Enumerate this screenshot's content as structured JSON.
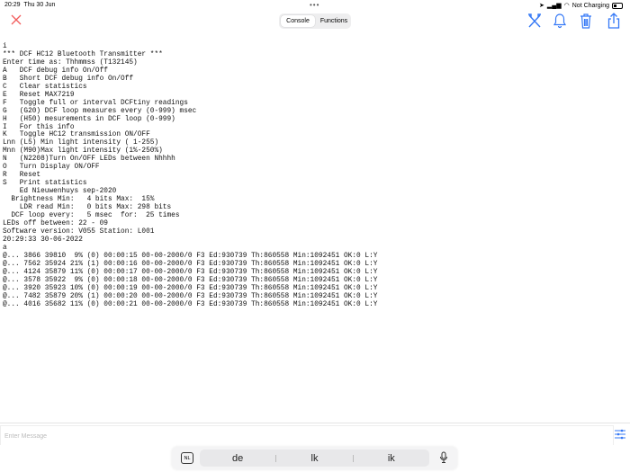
{
  "status_bar": {
    "time": "20:29",
    "date": "Thu 30 Jun",
    "dots": "•••",
    "battery_text": "Not Charging"
  },
  "toolbar": {
    "segments": [
      {
        "label": "Console",
        "active": true
      },
      {
        "label": "Functions",
        "active": false
      }
    ],
    "close_color": "#f25c5c",
    "accent": "#3478f6"
  },
  "console": {
    "lines": [
      "i",
      "*** DCF HC12 Bluetooth Transmitter ***",
      "Enter time as: Thhmmss (T132145)",
      "A   DCF debug info On/Off",
      "B   Short DCF debug info On/Off",
      "C   Clear statistics",
      "E   Reset MAX7219",
      "F   Toggle full or interval DCFtiny readings",
      "G   (G20) DCF loop measures every (0-999) msec",
      "H   (H50) mesurements in DCF loop (0-999)",
      "I   For this info",
      "K   Toggle HC12 transmission ON/OFF",
      "Lnn (L5) Min light intensity ( 1-255)",
      "Mnn (M90)Max light intensity (1%-250%)",
      "N   (N2208)Turn On/OFF LEDs between Nhhhh",
      "O   Turn Display ON/OFF",
      "R   Reset",
      "S   Print statistics",
      "    Ed Nieuwenhuys sep-2020",
      "  Brightness Min:   4 bits Max:  15%",
      "    LDR read Min:   0 bits Max: 298 bits",
      "  DCF loop every:   5 msec  for:  25 times",
      "LEDs off between: 22 - 09",
      "Software version: V055 Station: L001",
      "20:29:33 30-06-2022",
      "a",
      "@... 3866 39810  9% (0) 00:00:15 00-00-2000/0 F3 Ed:930739 Th:860558 Min:1092451 OK:0 L:Y",
      "@... 7562 35924 21% (1) 00:00:16 00-00-2000/0 F3 Ed:930739 Th:860558 Min:1092451 OK:0 L:Y",
      "@... 4124 35879 11% (0) 00:00:17 00-00-2000/0 F3 Ed:930739 Th:860558 Min:1092451 OK:0 L:Y",
      "@... 3578 35922  9% (0) 00:00:18 00-00-2000/0 F3 Ed:930739 Th:860558 Min:1092451 OK:0 L:Y",
      "@... 3920 35923 10% (0) 00:00:19 00-00-2000/0 F3 Ed:930739 Th:860558 Min:1092451 OK:0 L:Y",
      "@... 7482 35879 20% (1) 00:00:20 00-00-2000/0 F3 Ed:930739 Th:860558 Min:1092451 OK:0 L:Y",
      "@... 4016 35682 11% (0) 00:00:21 00-00-2000/0 F3 Ed:930739 Th:860558 Min:1092451 OK:0 L:Y"
    ]
  },
  "message": {
    "placeholder": "Enter Message",
    "value": ""
  },
  "keyboard": {
    "language": "NL",
    "suggestions": [
      "de",
      "lk",
      "ik"
    ]
  }
}
